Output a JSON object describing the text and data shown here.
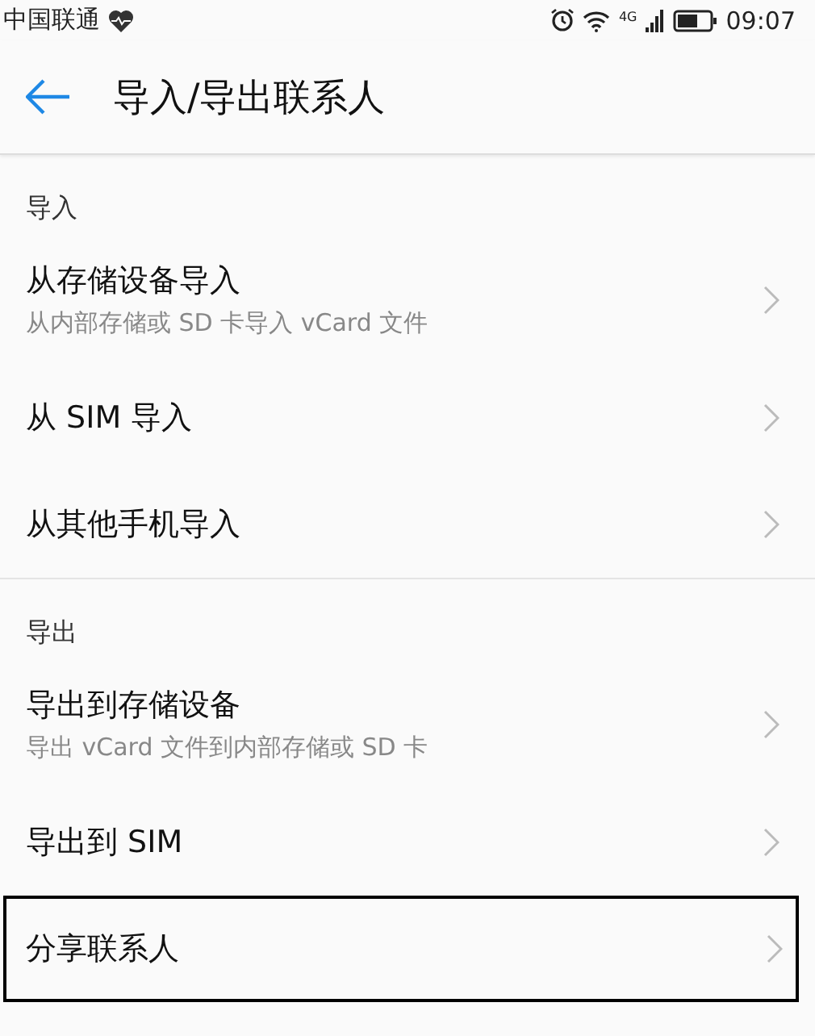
{
  "status_bar": {
    "carrier": "中国联通",
    "network": "4G",
    "time": "09:07"
  },
  "header": {
    "title": "导入/导出联系人"
  },
  "sections": [
    {
      "title": "导入",
      "items": [
        {
          "title": "从存储设备导入",
          "subtitle": "从内部存储或 SD 卡导入 vCard 文件",
          "highlighted": false
        },
        {
          "title": "从 SIM 导入",
          "highlighted": false
        },
        {
          "title": "从其他手机导入",
          "highlighted": false
        }
      ]
    },
    {
      "title": "导出",
      "items": [
        {
          "title": "导出到存储设备",
          "subtitle": "导出 vCard 文件到内部存储或 SD 卡",
          "highlighted": false
        },
        {
          "title": "导出到 SIM",
          "highlighted": false
        },
        {
          "title": "分享联系人",
          "highlighted": true
        }
      ]
    }
  ]
}
